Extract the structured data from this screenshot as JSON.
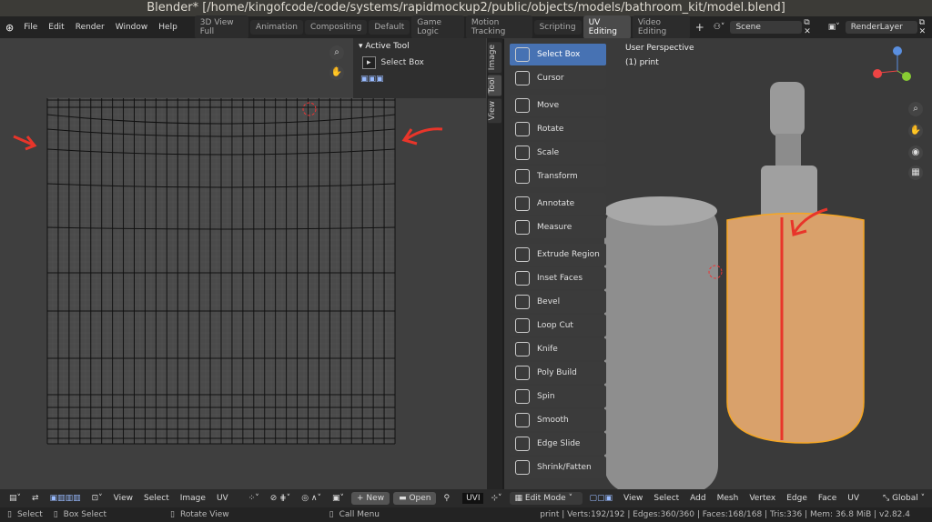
{
  "title": "Blender* [/home/kingofcode/code/systems/rapidmockup2/public/objects/models/bathroom_kit/model.blend]",
  "menu": [
    "File",
    "Edit",
    "Render",
    "Window",
    "Help"
  ],
  "workspaces": [
    "3D View Full",
    "Animation",
    "Compositing",
    "Default",
    "Game Logic",
    "Motion Tracking",
    "Scripting",
    "UV Editing",
    "Video Editing"
  ],
  "active_workspace": "UV Editing",
  "scene": "Scene",
  "render_layer": "RenderLayer",
  "uv_panel": {
    "header": "Active Tool",
    "tool": "Select Box",
    "tabs": [
      "Image",
      "Tool",
      "View"
    ]
  },
  "viewport": {
    "perspective": "User Perspective",
    "object": "(1) print"
  },
  "tools": [
    "Select Box",
    "Cursor",
    "Move",
    "Rotate",
    "Scale",
    "Transform",
    "Annotate",
    "Measure",
    "Extrude Region",
    "Inset Faces",
    "Bevel",
    "Loop Cut",
    "Knife",
    "Poly Build",
    "Spin",
    "Smooth",
    "Edge Slide",
    "Shrink/Fatten"
  ],
  "uv_header": {
    "menus": [
      "View",
      "Select",
      "Image",
      "UV"
    ],
    "new": "New",
    "open": "Open",
    "uvmap": "UVI"
  },
  "vp_header": {
    "mode": "Edit Mode",
    "menus": [
      "View",
      "Select",
      "Add",
      "Mesh",
      "Vertex",
      "Edge",
      "Face",
      "UV"
    ],
    "orientation": "Global"
  },
  "status": {
    "select": "Select",
    "box_select": "Box Select",
    "rotate": "Rotate View",
    "call_menu": "Call Menu",
    "stats": "print | Verts:192/192 | Edges:360/360 | Faces:168/168 | Tris:336 | Mem: 36.8 MiB | v2.82.4"
  },
  "colors": {
    "accent": "#4772b3",
    "selection": "#f5a623",
    "annotation": "#e8352a"
  }
}
